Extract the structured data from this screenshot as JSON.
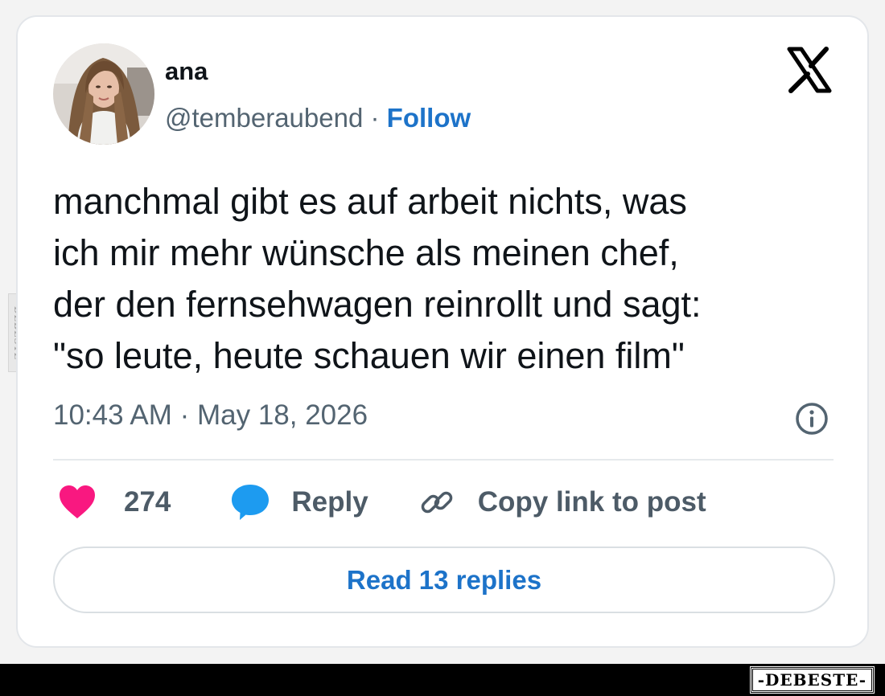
{
  "tweet": {
    "author_name": "ana",
    "handle": "@temberaubend",
    "separator": "·",
    "follow_label": "Follow",
    "text": "manchmal gibt es auf arbeit nichts, was\nich mir mehr wünsche als meinen chef,\nder den fernsehwagen reinrollt und sagt:\n\"so leute, heute schauen wir einen film\"",
    "timestamp": "10:43 AM · May 18, 2026",
    "like_count": "274",
    "reply_label": "Reply",
    "copy_link_label": "Copy link to post",
    "read_replies_label": "Read 13 replies"
  },
  "icons": {
    "platform_logo": "x-logo-icon",
    "info": "info-icon",
    "like": "heart-icon",
    "reply": "speech-bubble-icon",
    "copy_link": "link-icon"
  },
  "watermark": {
    "side_text": "DEBESTE",
    "footer_text": "-DEBESTE-"
  },
  "colors": {
    "accent_blue": "#1d73c9",
    "heart_pink": "#f91880",
    "reply_blue": "#1d9bf0",
    "text_primary": "#0f1419",
    "text_secondary": "#536471"
  }
}
